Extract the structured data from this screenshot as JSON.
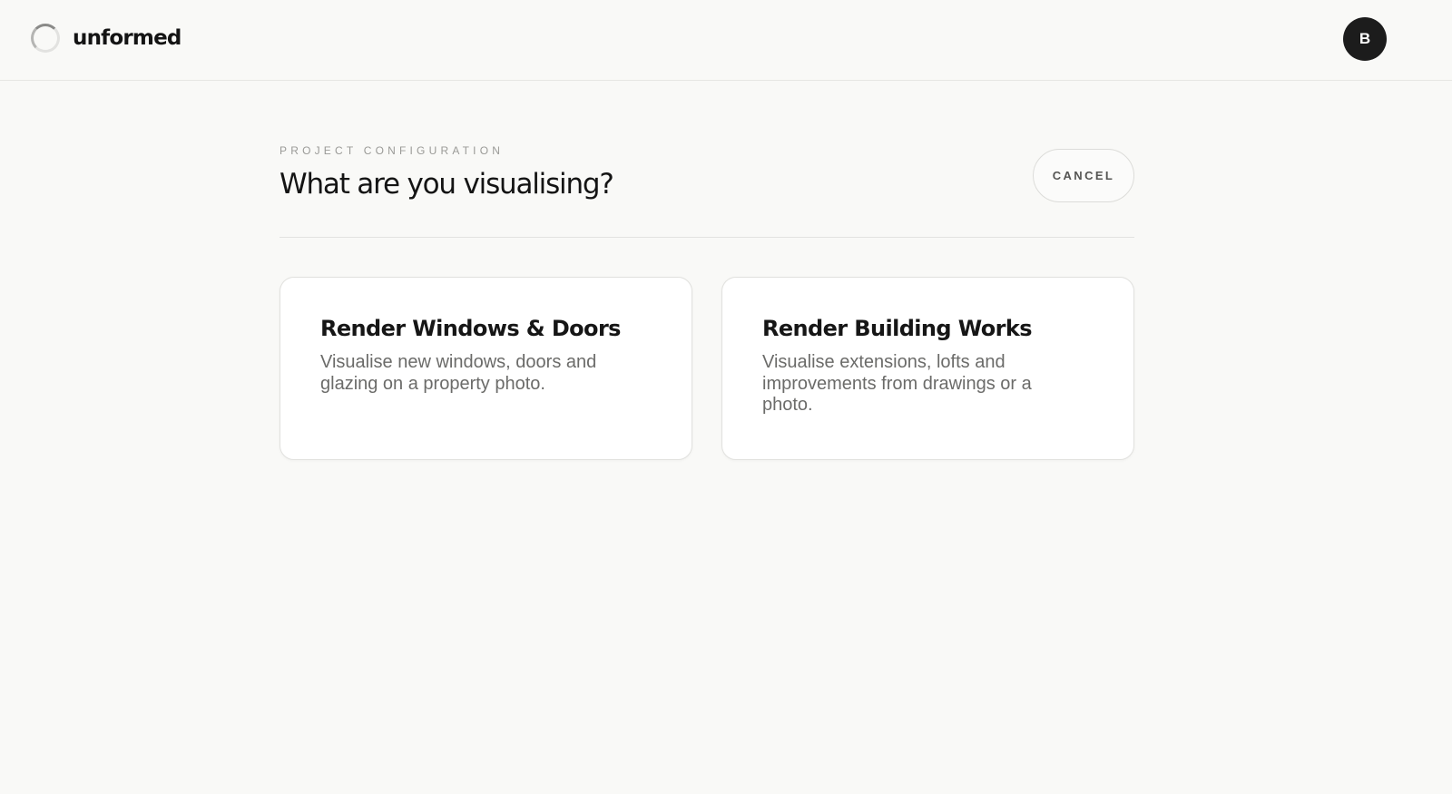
{
  "header": {
    "brand_name": "unformed",
    "logo_icon": "spinner-logo-icon",
    "avatar_initial": "B"
  },
  "main": {
    "eyebrow": "PROJECT CONFIGURATION",
    "title": "What are you visualising?",
    "cancel_label": "CANCEL",
    "options": [
      {
        "title": "Render Windows & Doors",
        "description": "Visualise new windows, doors and glazing on a property photo."
      },
      {
        "title": "Render Building Works",
        "description": "Visualise extensions, lofts and improvements from drawings or a photo."
      }
    ]
  },
  "colors": {
    "background": "#f9f9f7",
    "avatar": "#1c1c1c",
    "card": "#ffffff",
    "text_primary": "#141414",
    "text_muted": "#6b6b69"
  }
}
